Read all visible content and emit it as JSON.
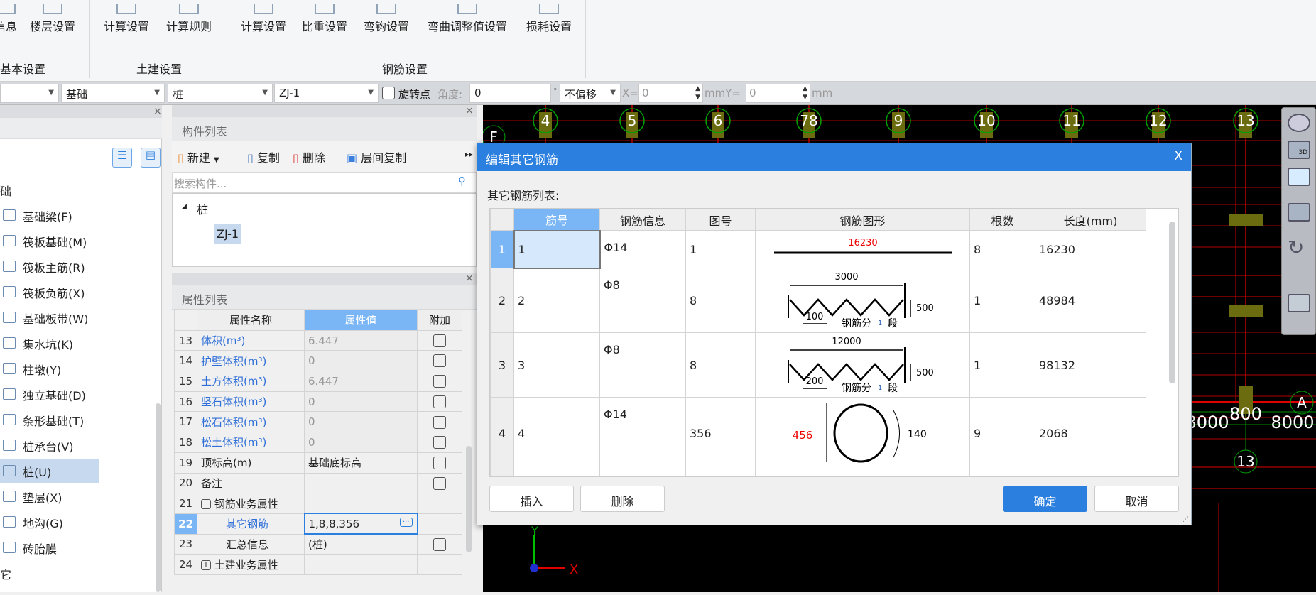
{
  "ribbon": {
    "buttons": [
      "信息",
      "楼层设置",
      "计算设置",
      "计算规则",
      "计算设置",
      "比重设置",
      "弯钩设置",
      "弯曲调整值设置",
      "损耗设置"
    ],
    "groups": [
      "基本设置",
      "土建设置",
      "钢筋设置"
    ]
  },
  "toolbar": {
    "combo0": "",
    "combo1": "基础",
    "combo2": "桩",
    "combo3": "ZJ-1",
    "rotate_point": "旋转点",
    "angle_label": "角度:",
    "angle_value": "0",
    "degree": "°",
    "offset": "不偏移",
    "x_label": "X=",
    "x_value": "0",
    "y_label": "mmY=",
    "y_value": "0",
    "mm": "mm"
  },
  "left_panel": {
    "group": "础",
    "items": [
      "基础梁(F)",
      "筏板基础(M)",
      "筏板主筋(R)",
      "筏板负筋(X)",
      "基础板带(W)",
      "集水坑(K)",
      "柱墩(Y)",
      "独立基础(D)",
      "条形基础(T)",
      "桩承台(V)",
      "桩(U)",
      "垫层(X)",
      "地沟(G)",
      "砖胎膜"
    ],
    "selected": "桩(U)",
    "trailing": "它"
  },
  "component_list": {
    "title": "构件列表",
    "new": "新建",
    "copy": "复制",
    "delete": "删除",
    "floor_copy": "层间复制",
    "search_placeholder": "搜索构件...",
    "tree_root": "桩",
    "tree_child": "ZJ-1"
  },
  "attr_list": {
    "title": "属性列表",
    "headers": [
      "属性名称",
      "属性值",
      "附加"
    ],
    "rows": [
      {
        "n": "13",
        "name": "体积(m³)",
        "value": "6.447"
      },
      {
        "n": "14",
        "name": "护壁体积(m³)",
        "value": "0"
      },
      {
        "n": "15",
        "name": "土方体积(m³)",
        "value": "6.447"
      },
      {
        "n": "16",
        "name": "坚石体积(m³)",
        "value": "0"
      },
      {
        "n": "17",
        "name": "松石体积(m³)",
        "value": "0"
      },
      {
        "n": "18",
        "name": "松土体积(m³)",
        "value": "0"
      },
      {
        "n": "19",
        "name": "顶标高(m)",
        "value": "基础底标高"
      },
      {
        "n": "20",
        "name": "备注",
        "value": ""
      },
      {
        "n": "21",
        "name": "钢筋业务属性",
        "value": ""
      },
      {
        "n": "22",
        "name": "其它钢筋",
        "value": "1,8,8,356"
      },
      {
        "n": "23",
        "name": "汇总信息",
        "value": "(桩)"
      },
      {
        "n": "24",
        "name": "土建业务属性",
        "value": ""
      }
    ]
  },
  "canvas": {
    "axes_top": [
      "4",
      "5",
      "6",
      "78",
      "9",
      "10",
      "11",
      "12",
      "13"
    ],
    "axis_left": "F",
    "axis_right": "A",
    "axis_bottom": "13",
    "dims": [
      "8000",
      "800",
      "8000"
    ],
    "x_axis": "X",
    "y_axis": "Y"
  },
  "dialog": {
    "title": "编辑其它钢筋",
    "close": "X",
    "list_label": "其它钢筋列表:",
    "headers": [
      "筋号",
      "钢筋信息",
      "图号",
      "钢筋图形",
      "根数",
      "长度(mm)"
    ],
    "rows": [
      {
        "rn": "1",
        "no": "1",
        "info": "Φ14",
        "fig": "1",
        "count": "8",
        "length": "16230",
        "shape": {
          "length": "16230"
        }
      },
      {
        "rn": "2",
        "no": "2",
        "info": "Φ8",
        "fig": "8",
        "count": "1",
        "length": "48984",
        "shape": {
          "top": "3000",
          "height": "500",
          "pitch": "100",
          "seg_pre": "钢筋分",
          "seg": "1",
          "seg_post": "段"
        }
      },
      {
        "rn": "3",
        "no": "3",
        "info": "Φ8",
        "fig": "8",
        "count": "1",
        "length": "98132",
        "shape": {
          "top": "12000",
          "height": "500",
          "pitch": "200",
          "seg_pre": "钢筋分",
          "seg": "1",
          "seg_post": "段"
        }
      },
      {
        "rn": "4",
        "no": "4",
        "info": "Φ14",
        "fig": "356",
        "count": "9",
        "length": "2068",
        "shape": {
          "dia": "456",
          "hook": "140"
        }
      }
    ],
    "insert": "插入",
    "delete": "删除",
    "ok": "确定",
    "cancel": "取消"
  },
  "colors": {
    "accent": "#2b7fde",
    "selected_header": "#7ab6f5",
    "canvas_bg": "#000000",
    "axis_red": "#d00000",
    "axis_green": "#00a000"
  }
}
